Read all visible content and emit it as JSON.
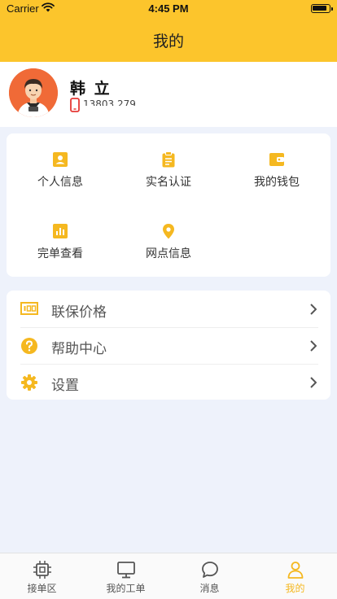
{
  "status_bar": {
    "carrier": "Carrier",
    "time": "4:45 PM"
  },
  "nav": {
    "title": "我的"
  },
  "profile": {
    "name": "韩 立",
    "phone": "13803  279"
  },
  "grid": [
    {
      "label": "个人信息",
      "icon": "person-card-icon"
    },
    {
      "label": "实名认证",
      "icon": "clipboard-icon"
    },
    {
      "label": "我的钱包",
      "icon": "wallet-icon"
    },
    {
      "label": "完单查看",
      "icon": "bar-chart-icon"
    },
    {
      "label": "网点信息",
      "icon": "location-pin-icon"
    }
  ],
  "menu": [
    {
      "label": "联保价格",
      "icon": "price-tag-icon"
    },
    {
      "label": "帮助中心",
      "icon": "help-icon"
    },
    {
      "label": "设置",
      "icon": "gear-icon"
    }
  ],
  "tabs": [
    {
      "label": "接单区",
      "icon": "chip-icon",
      "active": false
    },
    {
      "label": "我的工单",
      "icon": "monitor-icon",
      "active": false
    },
    {
      "label": "消息",
      "icon": "chat-bubble-icon",
      "active": false
    },
    {
      "label": "我的",
      "icon": "user-icon",
      "active": true
    }
  ],
  "colors": {
    "accent": "#fcc52c",
    "active_tab": "#f5b820",
    "background": "#eef2fb",
    "phone_icon": "#e53935"
  }
}
